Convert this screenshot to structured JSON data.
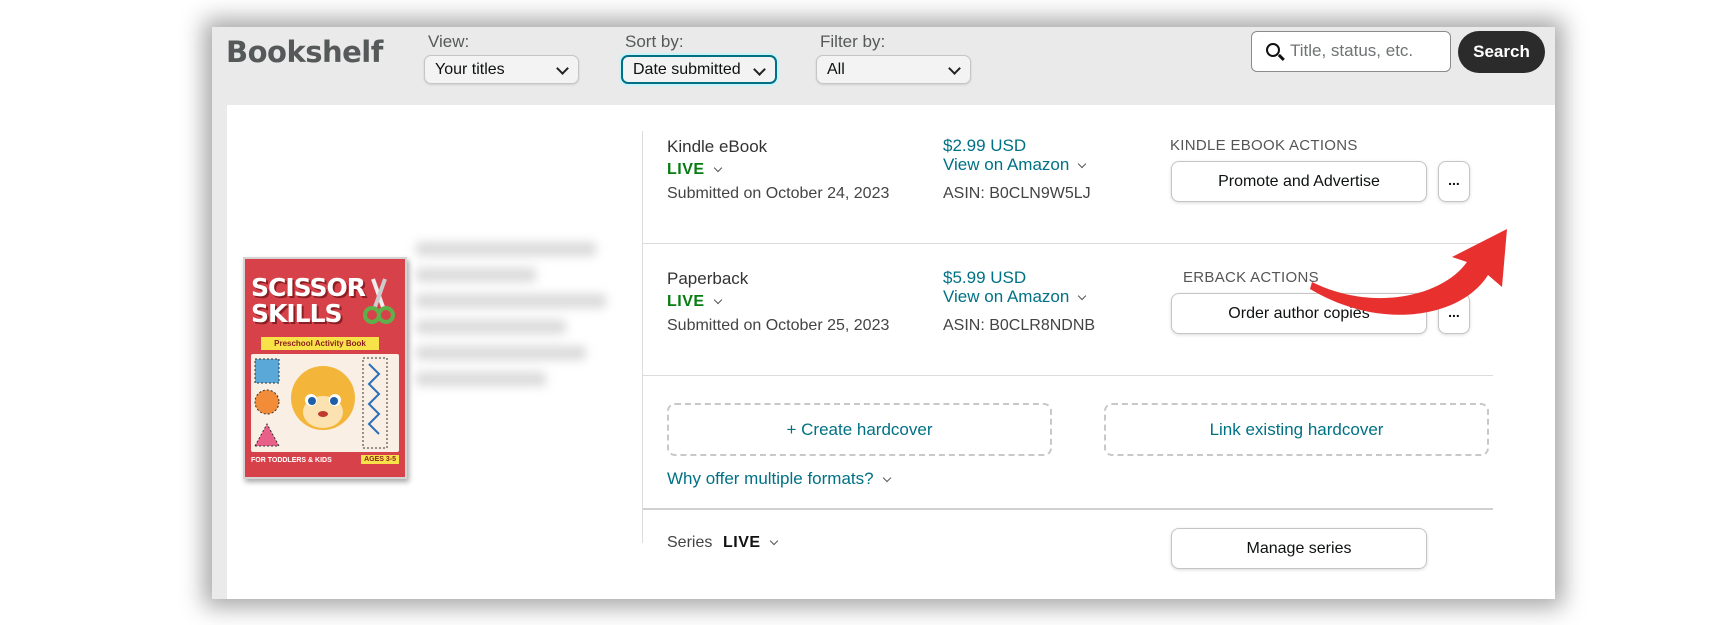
{
  "header": {
    "title": "Bookshelf",
    "view": {
      "label": "View:",
      "value": "Your titles"
    },
    "sort": {
      "label": "Sort by:",
      "value": "Date submitted"
    },
    "filter": {
      "label": "Filter by:",
      "value": "All"
    },
    "search": {
      "placeholder": "Title, status, etc.",
      "button_label": "Search"
    }
  },
  "book": {
    "cover": {
      "title_line1": "SCISSOR",
      "title_line2": "SKILLS",
      "subtitle": "Preschool Activity Book",
      "footer": "FOR TODDLERS & KIDS",
      "ages": "AGES 3-5"
    },
    "formats": [
      {
        "name": "Kindle eBook",
        "status": "LIVE",
        "submitted": "Submitted on October 24, 2023",
        "price": "$2.99 USD",
        "view_link": "View on Amazon",
        "asin": "ASIN: B0CLN9W5LJ",
        "actions_label": "KINDLE EBOOK ACTIONS",
        "action_button": "Promote and Advertise",
        "more": "..."
      },
      {
        "name": "Paperback",
        "status": "LIVE",
        "submitted": "Submitted on October 25, 2023",
        "price": "$5.99 USD",
        "view_link": "View on Amazon",
        "asin": "ASIN: B0CLR8NDNB",
        "actions_label": "ERBACK ACTIONS",
        "action_button": "Order author copies",
        "more": "..."
      }
    ],
    "hardcover": {
      "create": "+ Create hardcover",
      "link": "Link existing hardcover",
      "why": "Why offer multiple formats?"
    },
    "series": {
      "label": "Series",
      "status": "LIVE",
      "button": "Manage series"
    }
  },
  "colors": {
    "live_green": "#067d12",
    "link_teal": "#007185",
    "arrow_red": "#e8312f"
  },
  "icons": [
    "search-icon",
    "chevron-down-icon",
    "red-arrow-annotation"
  ]
}
